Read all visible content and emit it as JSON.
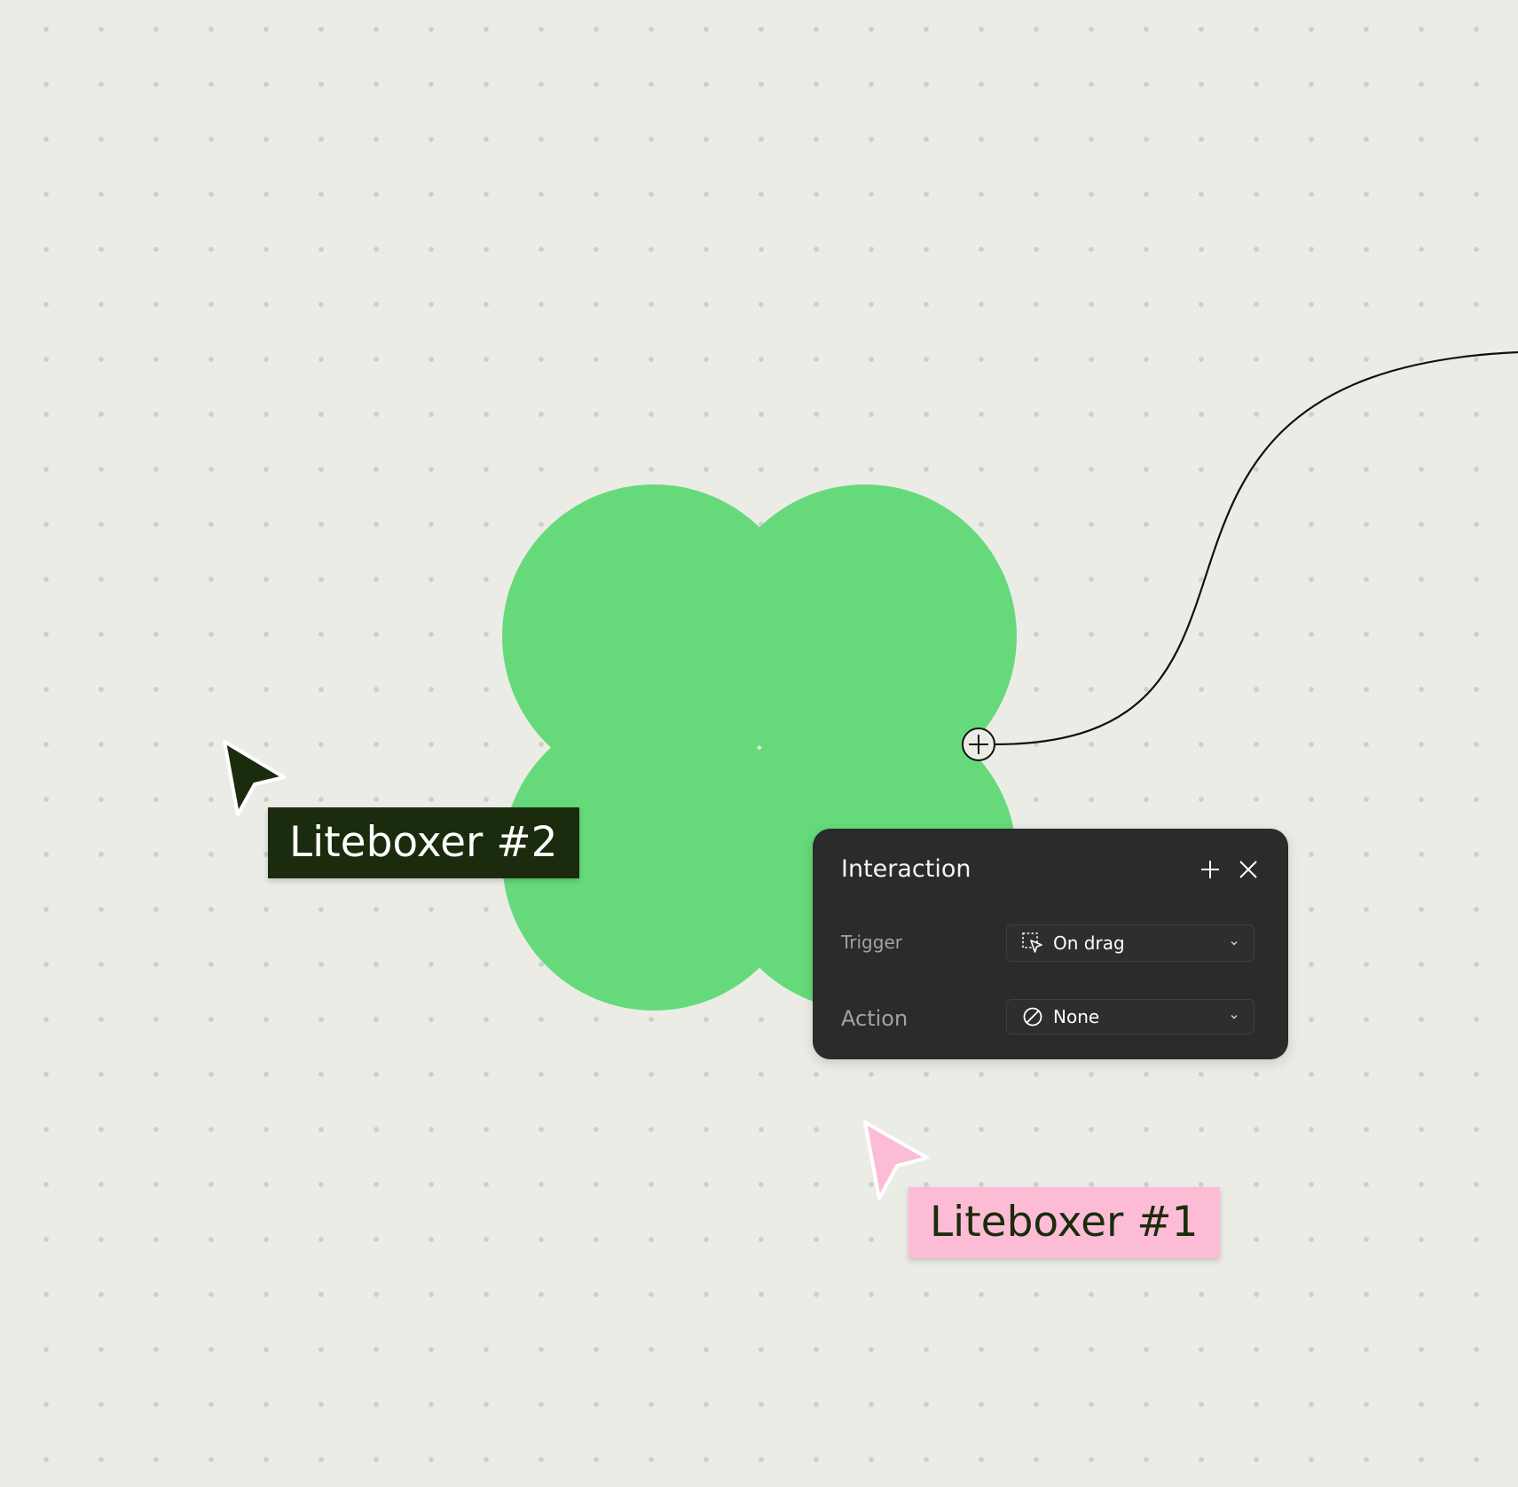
{
  "canvas": {
    "background_color": "#ecece7",
    "dot_color": "#cfcfca",
    "shape_color": "#66da7b",
    "connector_color": "#111111"
  },
  "cursors": [
    {
      "label": "Liteboxer #2",
      "pointer_color": "#1a2c0d",
      "label_background": "#1a2c0d",
      "label_text_color": "#ffffff"
    },
    {
      "label": "Liteboxer #1",
      "pointer_color": "#fdbcd6",
      "label_background": "#fdbcd6",
      "label_text_color": "#1a2c0d"
    }
  ],
  "interaction_panel": {
    "title": "Interaction",
    "add_icon": "plus-icon",
    "close_icon": "close-icon",
    "trigger": {
      "label": "Trigger",
      "value": "On drag",
      "icon": "drag-cursor-icon"
    },
    "action": {
      "label": "Action",
      "value": "None",
      "icon": "none-circle-slash-icon"
    },
    "background_color": "#2b2b2b"
  }
}
